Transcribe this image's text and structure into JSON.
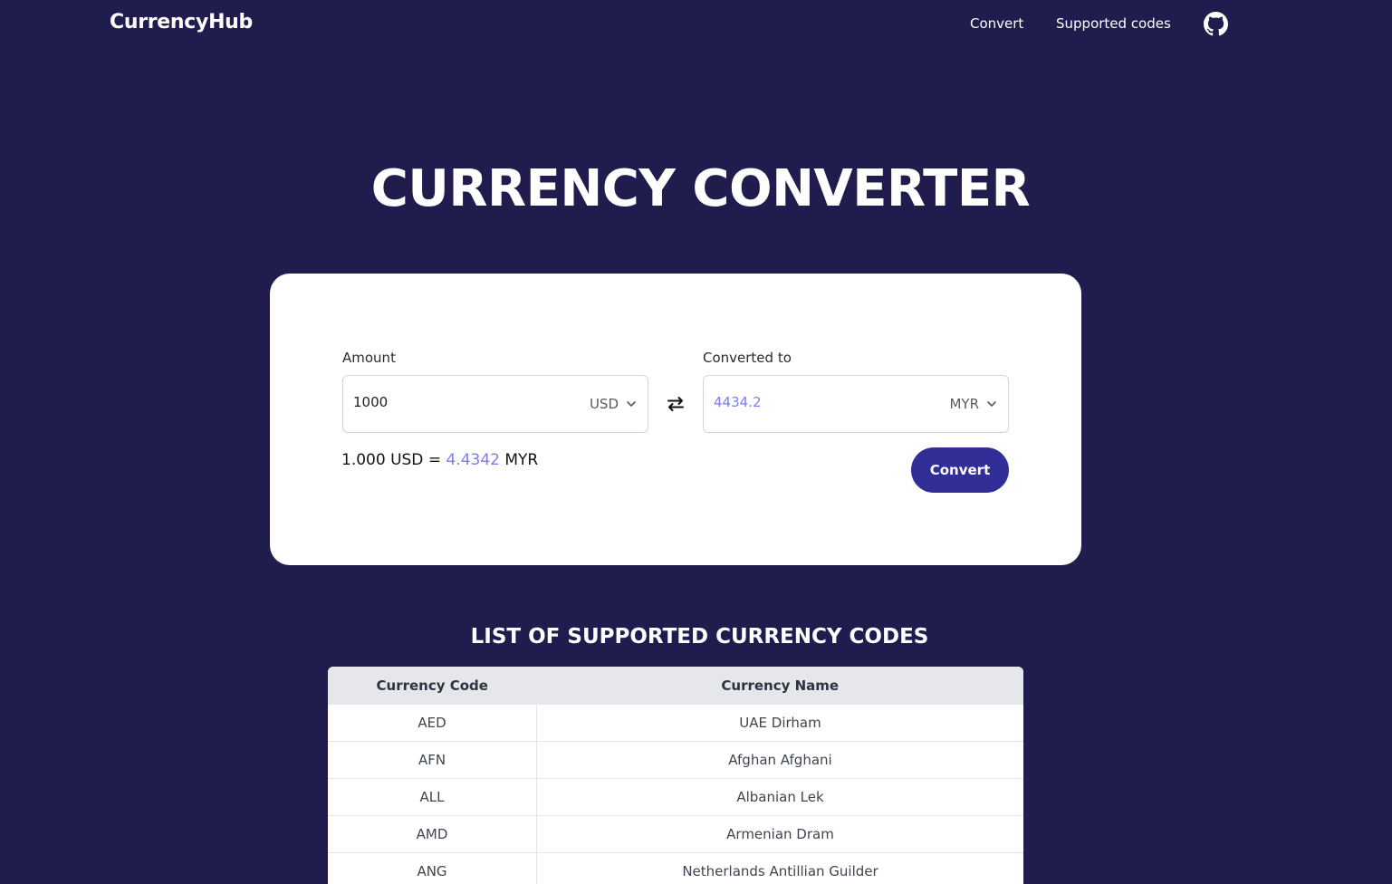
{
  "nav": {
    "brand": "CurrencyHub",
    "links": [
      "Convert",
      "Supported codes"
    ],
    "github_icon": "github-icon"
  },
  "hero": {
    "title": "CURRENCY CONVERTER"
  },
  "converter": {
    "amount_label": "Amount",
    "amount_value": "1000",
    "from_currency": "USD",
    "converted_label": "Converted to",
    "converted_value": "4434.2",
    "to_currency": "MYR",
    "swap_icon": "swap-arrows-icon",
    "rate": {
      "base": "1.000 USD",
      "equals": "=",
      "value": "4.4342",
      "target": "MYR"
    },
    "convert_button": "Convert",
    "accent_color": "#7b7df0",
    "button_color": "#312e98"
  },
  "codes": {
    "title": "LIST OF SUPPORTED CURRENCY CODES",
    "headers": [
      "Currency Code",
      "Currency Name"
    ],
    "rows": [
      [
        "AED",
        "UAE Dirham"
      ],
      [
        "AFN",
        "Afghan Afghani"
      ],
      [
        "ALL",
        "Albanian Lek"
      ],
      [
        "AMD",
        "Armenian Dram"
      ],
      [
        "ANG",
        "Netherlands Antillian Guilder"
      ]
    ]
  },
  "colors": {
    "background": "#201c4d",
    "card": "#ffffff",
    "table_header": "#e5e7eb"
  }
}
